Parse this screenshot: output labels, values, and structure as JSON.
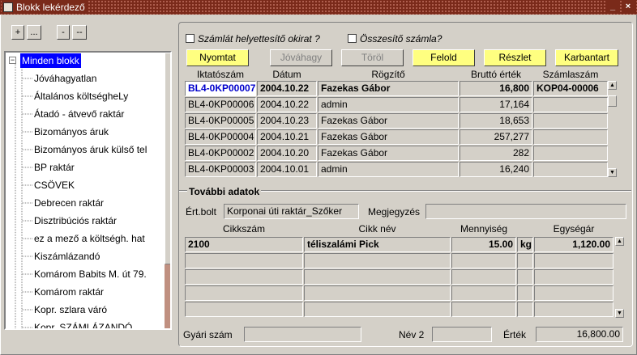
{
  "window": {
    "title": "Blokk lekérdező",
    "minimize": "_",
    "close": "×"
  },
  "tree_buttons": [
    "+",
    "...",
    "-",
    "--"
  ],
  "tree": {
    "root": "Minden blokk",
    "items": [
      "Jóváhagyatlan",
      "Általános költségheLy",
      "Átadó - átvevő raktár",
      "Bizományos áruk",
      "Bizományos áruk külső tel",
      "BP raktár",
      "CSÖVEK",
      "Debrecen raktár",
      "Disztribúciós raktár",
      "ez a mező a költségh. hat",
      "Kiszámlázandó",
      "Komárom Babits M. út 79.",
      "Komárom raktár",
      "Kopr. szlara váró",
      "Kopr. SZÁMLÁZANDÓ"
    ]
  },
  "checkboxes": {
    "invoice_substitute": "Számlát helyettesítő okirat ?",
    "summary_invoice": "Összesítő számla?"
  },
  "buttons": {
    "print": "Nyomtat",
    "approve": "Jóváhagy",
    "delete": "Töröl",
    "release": "Felold",
    "detail": "Részlet",
    "maintain": "Karbantart"
  },
  "blocks_table": {
    "columns": [
      "Iktatószám",
      "Dátum",
      "Rögzítő",
      "Bruttó érték",
      "Számlaszám"
    ],
    "rows": [
      [
        "BL4-0KP00007",
        "2004.10.22",
        "Fazekas Gábor",
        "16,800",
        "KOP04-00006"
      ],
      [
        "BL4-0KP00006",
        "2004.10.22",
        "admin",
        "17,164",
        ""
      ],
      [
        "BL4-0KP00005",
        "2004.10.23",
        "Fazekas Gábor",
        "18,653",
        ""
      ],
      [
        "BL4-0KP00004",
        "2004.10.21",
        "Fazekas Gábor",
        "257,277",
        ""
      ],
      [
        "BL4-0KP00002",
        "2004.10.20",
        "Fazekas Gábor",
        "282",
        ""
      ],
      [
        "BL4-0KP00003",
        "2004.10.01",
        "admin",
        "16,240",
        ""
      ]
    ]
  },
  "details": {
    "title": "További adatok",
    "warehouse_label": "Ért.bolt",
    "warehouse_value": "Korponai úti raktár_Szőker",
    "note_label": "Megjegyzés",
    "note_value": ""
  },
  "items_table": {
    "columns": [
      "Cikkszám",
      "Cikk név",
      "Mennyiség",
      "Egységár"
    ],
    "rows": [
      [
        "2100",
        "téliszalámi Pick",
        "15.00",
        "kg",
        "1,120.00"
      ],
      [
        "",
        "",
        "",
        "",
        ""
      ],
      [
        "",
        "",
        "",
        "",
        ""
      ],
      [
        "",
        "",
        "",
        "",
        ""
      ],
      [
        "",
        "",
        "",
        "",
        ""
      ]
    ]
  },
  "footer": {
    "serial_label": "Gyári szám",
    "serial_value": "",
    "name2_label": "Név 2",
    "name2_value": "",
    "value_label": "Érték",
    "value_value": "16,800.00"
  }
}
